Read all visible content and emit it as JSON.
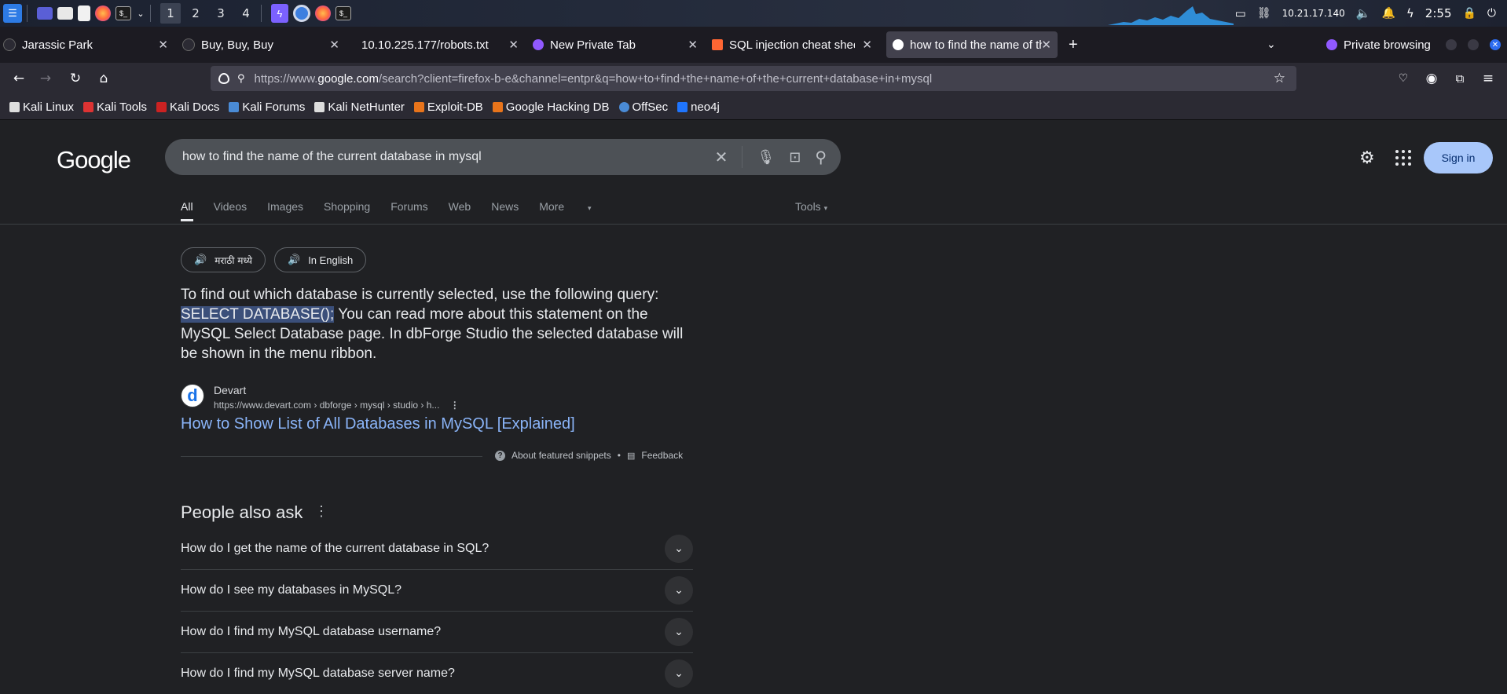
{
  "taskbar": {
    "workspaces": [
      "1",
      "2",
      "3",
      "4"
    ],
    "ip": "10.21.17.140",
    "time": "2:55"
  },
  "tabs": [
    {
      "title": "Jarassic Park"
    },
    {
      "title": "Buy, Buy, Buy"
    },
    {
      "title": "10.10.225.177/robots.txt"
    },
    {
      "title": "New Private Tab"
    },
    {
      "title": "SQL injection cheat sheet"
    },
    {
      "title": "how to find the name of the"
    }
  ],
  "private_browsing_label": "Private browsing",
  "url": {
    "prefix": "https://www.",
    "domain": "google.com",
    "rest": "/search?client=firefox-b-e&channel=entpr&q=how+to+find+the+name+of+the+current+database+in+mysql"
  },
  "bookmarks": [
    "Kali Linux",
    "Kali Tools",
    "Kali Docs",
    "Kali Forums",
    "Kali NetHunter",
    "Exploit-DB",
    "Google Hacking DB",
    "OffSec",
    "neo4j"
  ],
  "google": {
    "logo": "Google",
    "query": "how to find the name of the current database in mysql",
    "signin": "Sign in",
    "filters": [
      "All",
      "Videos",
      "Images",
      "Shopping",
      "Forums",
      "Web",
      "News",
      "More"
    ],
    "tools": "Tools",
    "chips": [
      "मराठी मध्ये",
      "In English"
    ],
    "snippet_before": "To find out which database is currently selected, use the following query: ",
    "snippet_highlight": "SELECT DATABASE();",
    "snippet_after": " You can read more about this statement on the MySQL Select Database page. In dbForge Studio the selected database will be shown in the menu ribbon.",
    "source_name": "Devart",
    "source_cite": "https://www.devart.com › dbforge › mysql › studio › h...",
    "result_title": "How to Show List of All Databases in MySQL [Explained]",
    "about_snippets": "About featured snippets",
    "feedback": "Feedback",
    "paa_title": "People also ask",
    "paa": [
      "How do I get the name of the current database in SQL?",
      "How do I see my databases in MySQL?",
      "How do I find my MySQL database username?",
      "How do I find my MySQL database server name?"
    ]
  }
}
